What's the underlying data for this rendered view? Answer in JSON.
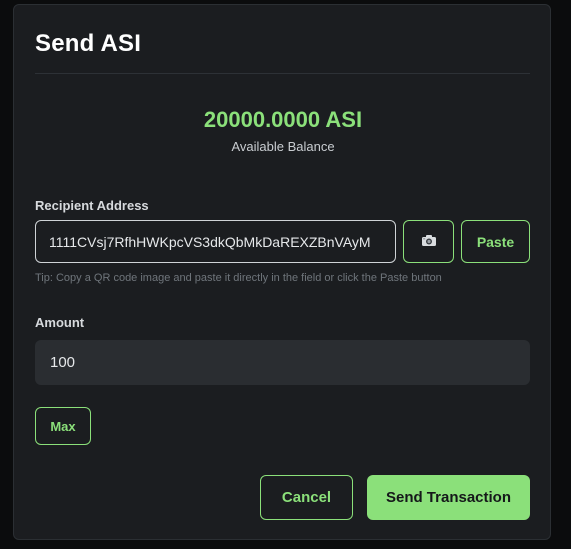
{
  "dialog": {
    "title": "Send ASI"
  },
  "balance": {
    "amount": "20000.0000 ASI",
    "label": "Available Balance"
  },
  "recipient": {
    "label": "Recipient Address",
    "value": "1111CVsj7RfhHWKpcVS3dkQbMkDaREXZBnVAyM",
    "camera_icon": "camera-icon",
    "paste_label": "Paste",
    "tip": "Tip: Copy a QR code image and paste it directly in the field or click the Paste button"
  },
  "amount": {
    "label": "Amount",
    "value": "100",
    "max_label": "Max"
  },
  "actions": {
    "cancel_label": "Cancel",
    "send_label": "Send Transaction"
  },
  "colors": {
    "accent": "#8be07a",
    "background": "#1b1d20",
    "input_fill": "#2a2d31"
  }
}
